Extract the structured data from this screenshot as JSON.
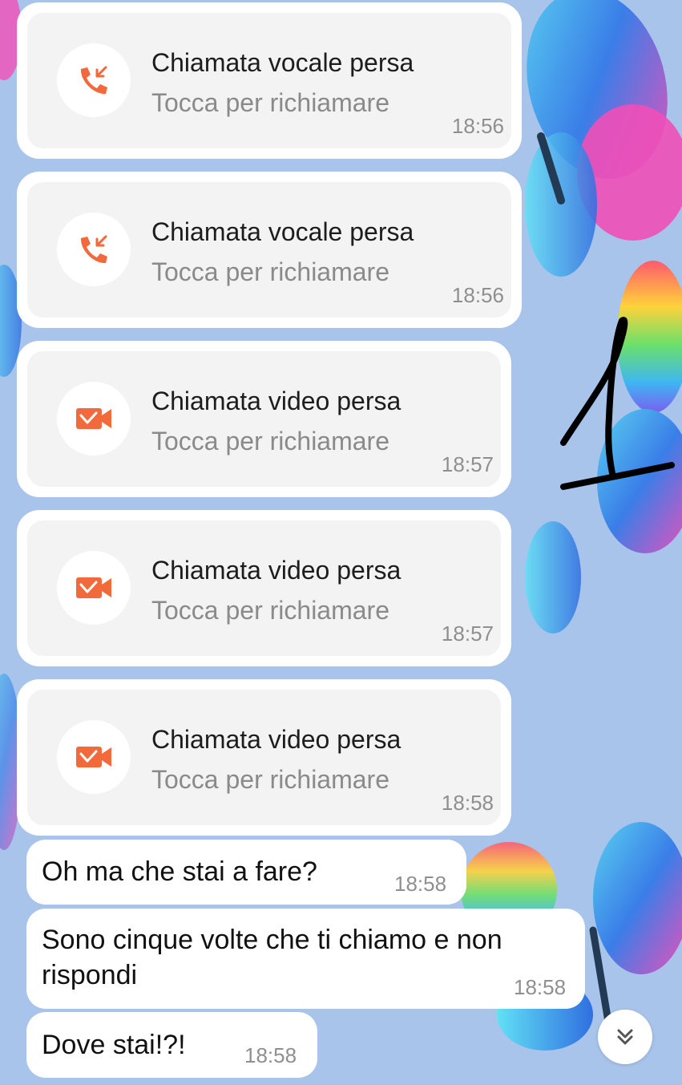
{
  "colors": {
    "accent": "#f26a3c",
    "background": "#a8c4ea",
    "card": "#ffffff",
    "card_inner": "#f3f3f3"
  },
  "calls": [
    {
      "type": "voice",
      "icon": "missed-voice-call-icon",
      "title": "Chiamata vocale persa",
      "subtitle": "Tocca per richiamare",
      "time": "18:56"
    },
    {
      "type": "voice",
      "icon": "missed-voice-call-icon",
      "title": "Chiamata vocale persa",
      "subtitle": "Tocca per richiamare",
      "time": "18:56"
    },
    {
      "type": "video",
      "icon": "missed-video-call-icon",
      "title": "Chiamata video persa",
      "subtitle": "Tocca per richiamare",
      "time": "18:57"
    },
    {
      "type": "video",
      "icon": "missed-video-call-icon",
      "title": "Chiamata video persa",
      "subtitle": "Tocca per richiamare",
      "time": "18:57"
    },
    {
      "type": "video",
      "icon": "missed-video-call-icon",
      "title": "Chiamata video persa",
      "subtitle": "Tocca per richiamare",
      "time": "18:58"
    }
  ],
  "messages": [
    {
      "text": "Oh ma che stai a fare?",
      "time": "18:58"
    },
    {
      "text": "Sono cinque volte che ti chiamo e non rispondi",
      "time": "18:58"
    },
    {
      "text": "Dove stai!?!",
      "time": "18:58"
    }
  ],
  "annotation": "1",
  "scroll_button": {
    "icon": "double-chevron-down-icon"
  }
}
